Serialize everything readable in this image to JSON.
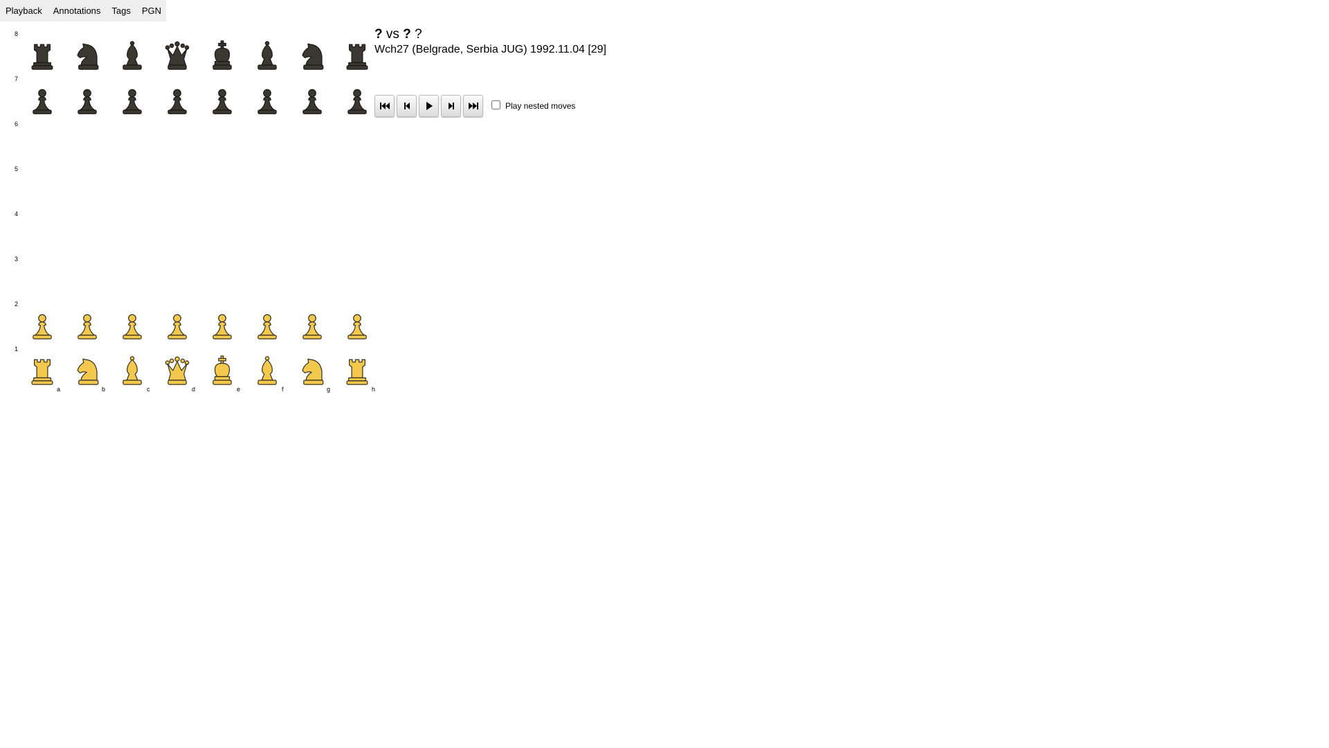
{
  "tabs": [
    "Playback",
    "Annotations",
    "Tags",
    "PGN"
  ],
  "game": {
    "white": "?",
    "vs": "vs",
    "black": "?",
    "result": "?",
    "event_line": "Wch27 (Belgrade, Serbia JUG) 1992.11.04 [29]"
  },
  "board": {
    "ranks": [
      "8",
      "7",
      "6",
      "5",
      "4",
      "3",
      "2",
      "1"
    ],
    "files": [
      "a",
      "b",
      "c",
      "d",
      "e",
      "f",
      "g",
      "h"
    ],
    "position": [
      [
        "r",
        "n",
        "b",
        "q",
        "k",
        "b",
        "n",
        "r"
      ],
      [
        "p",
        "p",
        "p",
        "p",
        "p",
        "p",
        "p",
        "p"
      ],
      [
        "",
        "",
        "",
        "",
        "",
        "",
        "",
        ""
      ],
      [
        "",
        "",
        "",
        "",
        "",
        "",
        "",
        ""
      ],
      [
        "",
        "",
        "",
        "",
        "",
        "",
        "",
        ""
      ],
      [
        "",
        "",
        "",
        "",
        "",
        "",
        "",
        ""
      ],
      [
        "P",
        "P",
        "P",
        "P",
        "P",
        "P",
        "P",
        "P"
      ],
      [
        "R",
        "N",
        "B",
        "Q",
        "K",
        "B",
        "N",
        "R"
      ]
    ],
    "piece_names": {
      "k": "king",
      "q": "queen",
      "r": "rook",
      "b": "bishop",
      "n": "knight",
      "p": "pawn"
    },
    "colors": {
      "white_fill": "#f2c94c",
      "white_stroke": "#3a3020",
      "black_fill": "#3b3833",
      "black_stroke": "#1c1a17"
    }
  },
  "controls": {
    "buttons": [
      {
        "name": "first-move-button",
        "icon": "skip-to-start-icon"
      },
      {
        "name": "previous-move-button",
        "icon": "step-back-icon"
      },
      {
        "name": "play-button",
        "icon": "play-icon"
      },
      {
        "name": "next-move-button",
        "icon": "step-forward-icon"
      },
      {
        "name": "last-move-button",
        "icon": "skip-to-end-icon"
      }
    ],
    "nested_label": "Play nested moves",
    "nested_checked": false
  }
}
